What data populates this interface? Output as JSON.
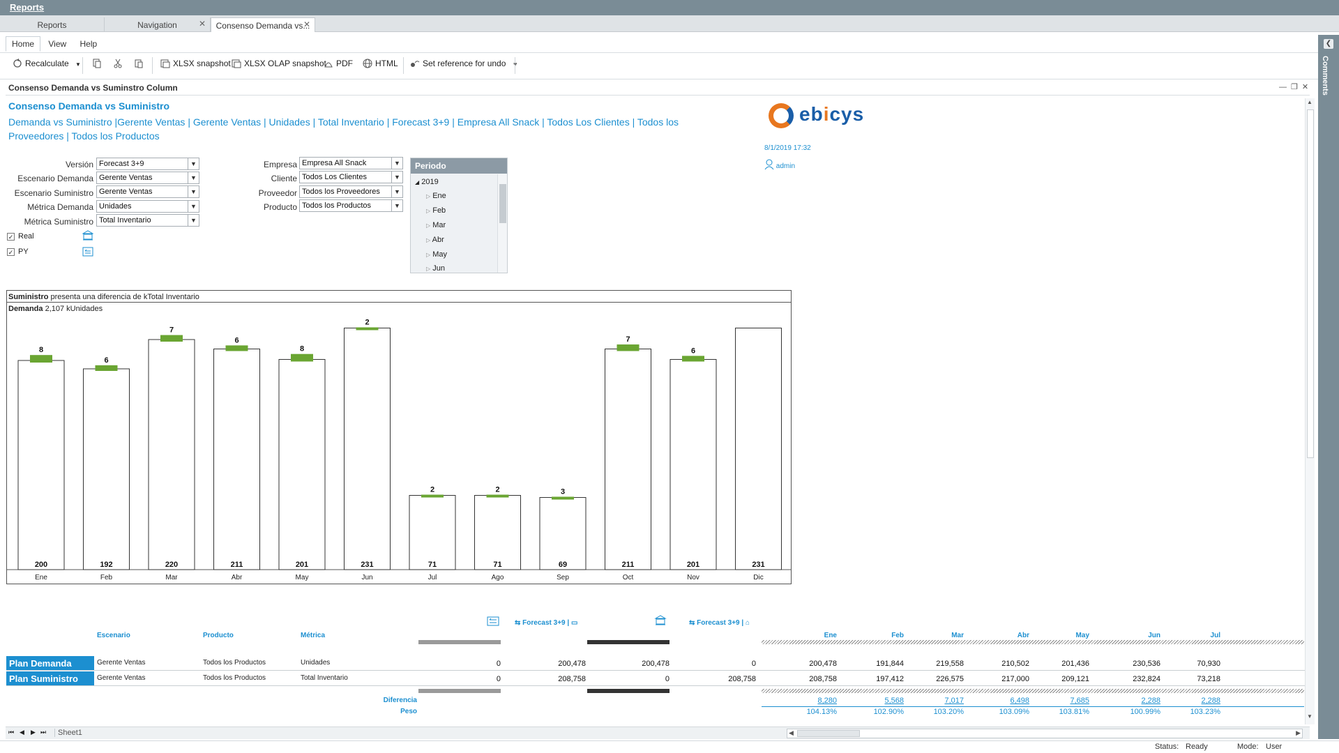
{
  "app": {
    "title": "Reports"
  },
  "doc_tabs": [
    {
      "label": "Reports"
    },
    {
      "label": "Navigation"
    },
    {
      "label": "Consenso Demanda vs..."
    }
  ],
  "menu_tabs": [
    "Home",
    "View",
    "Help"
  ],
  "toolbar": {
    "recalculate": "Recalculate",
    "xlsx_snapshot": "XLSX snapshot",
    "xlsx_olap_snapshot": "XLSX OLAP snapshot",
    "pdf": "PDF",
    "html": "HTML",
    "set_reference": "Set reference for undo"
  },
  "comments_panel": {
    "label": "Comments"
  },
  "report": {
    "window_title": "Consenso Demanda vs Suminstro Column",
    "title": "Consenso Demanda vs Suministro",
    "description": "Demanda vs Suministro |Gerente Ventas | Gerente Ventas | Unidades | Total Inventario | Forecast 3+9 | Empresa All Snack | Todos Los Clientes | Todos los Proveedores | Todos los Productos",
    "logo_text_a": "eb",
    "logo_text_b": "i",
    "logo_text_c": "cys",
    "datetime": "8/1/2019 17:32",
    "user": "admin"
  },
  "filters_left": [
    {
      "label": "Versión",
      "value": "Forecast 3+9"
    },
    {
      "label": "Escenario Demanda",
      "value": "Gerente Ventas"
    },
    {
      "label": "Escenario Suministro",
      "value": "Gerente Ventas"
    },
    {
      "label": "Métrica Demanda",
      "value": "Unidades"
    },
    {
      "label": "Métrica Suministro",
      "value": "Total Inventario"
    }
  ],
  "filters_right": [
    {
      "label": "Empresa",
      "value": "Empresa All Snack"
    },
    {
      "label": "Cliente",
      "value": "Todos Los Clientes"
    },
    {
      "label": "Proveedor",
      "value": "Todos los Proveedores"
    },
    {
      "label": "Producto",
      "value": "Todos los Productos"
    }
  ],
  "checkboxes": [
    {
      "label": "Real",
      "checked": true
    },
    {
      "label": "PY",
      "checked": true
    }
  ],
  "periodo": {
    "header": "Periodo",
    "year": "2019",
    "months": [
      "Ene",
      "Feb",
      "Mar",
      "Abr",
      "May",
      "Jun"
    ]
  },
  "chart_header": {
    "line1_bold": "Suministro",
    "line1_rest": " presenta una diferencia de  kTotal Inventario",
    "line2_bold": "Demanda",
    "line2_rest": " 2,107 kUnidades"
  },
  "chart_data": {
    "type": "bar",
    "categories": [
      "Ene",
      "Feb",
      "Mar",
      "Abr",
      "May",
      "Jun",
      "Jul",
      "Ago",
      "Sep",
      "Oct",
      "Nov",
      "Dic"
    ],
    "series": [
      {
        "values": [
          200,
          192,
          220,
          211,
          201,
          231,
          71,
          71,
          69,
          211,
          201,
          231
        ]
      },
      {
        "values": [
          8,
          6,
          7,
          6,
          8,
          2,
          2,
          2,
          3,
          7,
          6,
          null
        ]
      }
    ],
    "colors": {
      "demand_fill": "#ffffff",
      "difference_fill": "#6aa532",
      "outline": "#333333"
    },
    "ylim": [
      0,
      240
    ]
  },
  "grid": {
    "headers": {
      "escenario": "Escenario",
      "producto": "Producto",
      "metrica": "Métrica"
    },
    "scenario_label_1": "Forecast 3+9 |",
    "scenario_label_2": "Forecast 3+9 |",
    "months": [
      "Ene",
      "Feb",
      "Mar",
      "Abr",
      "May",
      "Jun",
      "Jul"
    ],
    "rows": [
      {
        "label": "Plan Demanda",
        "escenario": "Gerente Ventas",
        "producto": "Todos los Productos",
        "metrica": "Unidades",
        "c1": "0",
        "c2": "200,478",
        "c3": "200,478",
        "c4": "0",
        "months": [
          "200,478",
          "191,844",
          "219,558",
          "210,502",
          "201,436",
          "230,536",
          "70,930"
        ]
      },
      {
        "label": "Plan Suministro",
        "escenario": "Gerente Ventas",
        "producto": "Todos los Productos",
        "metrica": "Total Inventario",
        "c1": "0",
        "c2": "208,758",
        "c3": "0",
        "c4": "208,758",
        "months": [
          "208,758",
          "197,412",
          "226,575",
          "217,000",
          "209,121",
          "232,824",
          "73,218"
        ]
      }
    ],
    "diferencia_label": "Diferencia",
    "peso_label": "Peso",
    "diferencia": [
      "8,280",
      "5,568",
      "7,017",
      "6,498",
      "7,685",
      "2,288",
      "2,288"
    ],
    "peso": [
      "104.13%",
      "102.90%",
      "103.20%",
      "103.09%",
      "103.81%",
      "100.99%",
      "103.23%"
    ]
  },
  "sheet": {
    "name": "Sheet1"
  },
  "status": {
    "status_label": "Status:",
    "status_value": "Ready",
    "mode_label": "Mode:",
    "mode_value": "User"
  }
}
